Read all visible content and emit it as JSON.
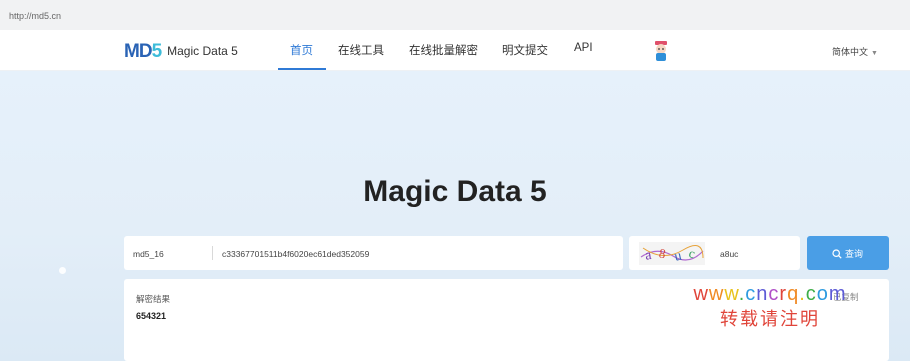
{
  "browser": {
    "url": "http://md5.cn"
  },
  "nav": {
    "logo_mark": "MD5",
    "logo_text": "Magic Data 5",
    "items": [
      "首页",
      "在线工具",
      "在线批量解密",
      "明文提交",
      "API"
    ],
    "language": "简体中文",
    "accent_color": "#2f7ad6"
  },
  "hero": {
    "title": "Magic Data 5"
  },
  "search": {
    "algorithm": "md5_16",
    "hash_value": "c33367701511b4f6020ec61ded352059",
    "captcha_image_text": "a8uc",
    "captcha_value": "a8uc",
    "button_label": "查询",
    "button_color": "#4a9ee6"
  },
  "result": {
    "label": "解密结果",
    "value": "654321",
    "copy_label": "已复制"
  },
  "watermark": {
    "line1": "www.cncrq.com",
    "line2": "转载请注明"
  }
}
